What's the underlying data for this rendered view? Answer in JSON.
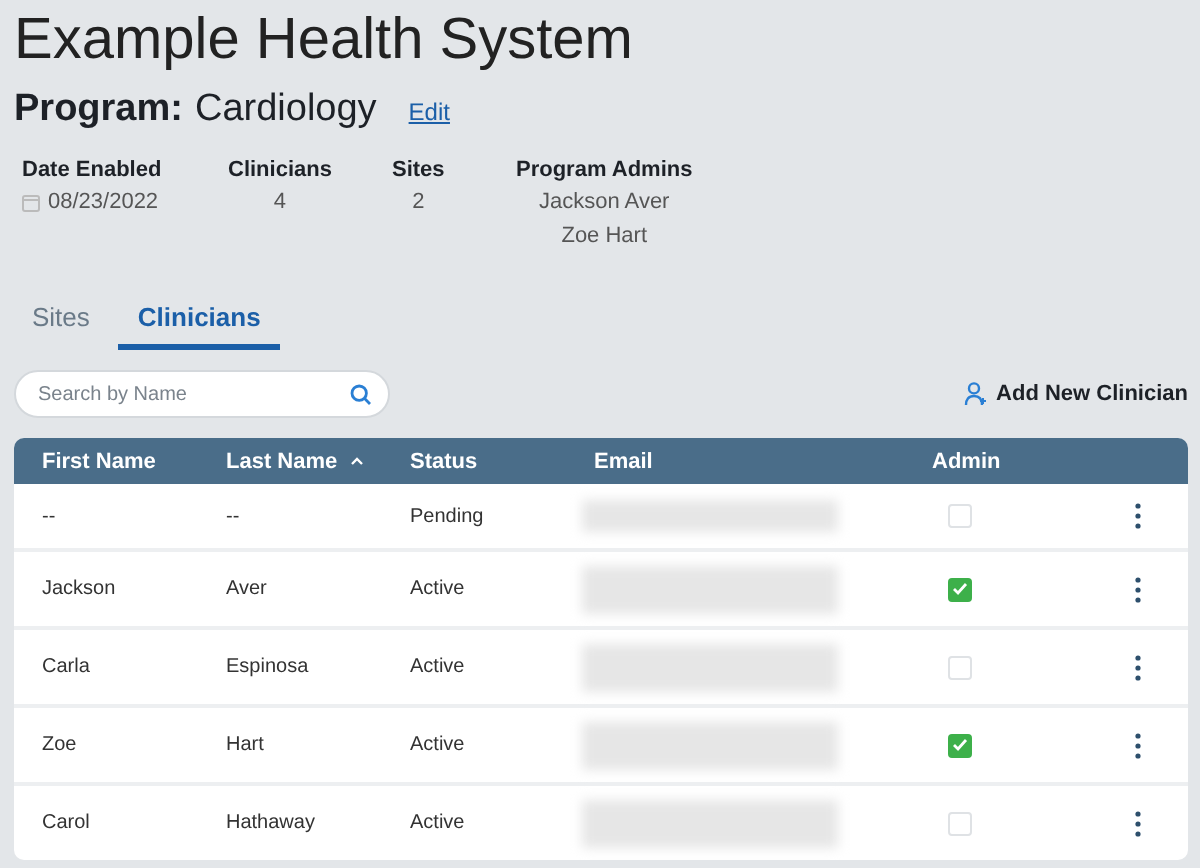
{
  "title": "Example Health System",
  "program": {
    "label": "Program:",
    "name": "Cardiology",
    "edit": "Edit"
  },
  "stats": [
    {
      "label": "Date Enabled",
      "values": [
        "08/23/2022"
      ],
      "kind": "date"
    },
    {
      "label": "Clinicians",
      "values": [
        "4"
      ],
      "kind": "plain"
    },
    {
      "label": "Sites",
      "values": [
        "2"
      ],
      "kind": "plain"
    },
    {
      "label": "Program Admins",
      "values": [
        "Jackson Aver",
        "Zoe Hart"
      ],
      "kind": "plain"
    }
  ],
  "tabs": [
    {
      "label": "Sites",
      "selected": false
    },
    {
      "label": "Clinicians",
      "selected": true
    }
  ],
  "search": {
    "placeholder": "Search by Name"
  },
  "add_button": "Add New Clinician",
  "table": {
    "columns": [
      {
        "label": "First Name",
        "sorted": false
      },
      {
        "label": "Last Name",
        "sorted": true
      },
      {
        "label": "Status",
        "sorted": false
      },
      {
        "label": "Email",
        "sorted": false
      },
      {
        "label": "Admin",
        "sorted": false
      }
    ],
    "rows": [
      {
        "first": "--",
        "last": "--",
        "status": "Pending",
        "admin": false
      },
      {
        "first": "Jackson",
        "last": "Aver",
        "status": "Active",
        "admin": true
      },
      {
        "first": "Carla",
        "last": "Espinosa",
        "status": "Active",
        "admin": false
      },
      {
        "first": "Zoe",
        "last": "Hart",
        "status": "Active",
        "admin": true
      },
      {
        "first": "Carol",
        "last": "Hathaway",
        "status": "Active",
        "admin": false
      }
    ]
  }
}
